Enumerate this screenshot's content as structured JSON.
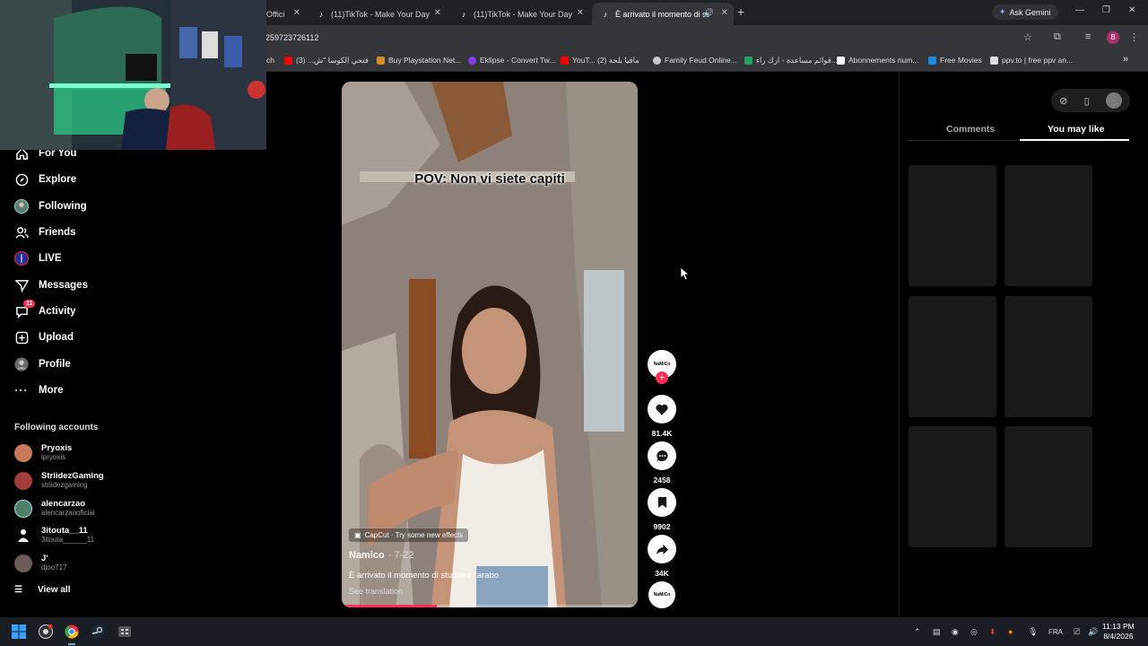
{
  "browser": {
    "tabs": [
      {
        "title": "Offici",
        "active": false
      },
      {
        "title": "(11)TikTok - Make Your Day",
        "active": false
      },
      {
        "title": "(11)TikTok - Make Your Day",
        "active": false
      },
      {
        "title": "È arrivato il momento di stu",
        "active": true
      }
    ],
    "ask_gemini": "Ask Gemini",
    "url": "259723726112",
    "profile_initial": "B",
    "bookmarks": [
      {
        "label": "ch",
        "color": "#888888"
      },
      {
        "label": "فتحي الكوسا \"ش... (3)",
        "color": "#ff0000"
      },
      {
        "label": "Buy Playstation Net...",
        "color": "#d58b2a"
      },
      {
        "label": "Eklipse - Convert Tw...",
        "color": "#8a3bf2"
      },
      {
        "label": "YouT... مافيا بلحة (2)",
        "color": "#ff0000"
      },
      {
        "label": "Family Feud Online...",
        "color": "#cccccc"
      },
      {
        "label": "قوائم مساعدة - ارك راء...",
        "color": "#1ea362"
      },
      {
        "label": "Abonnements num...",
        "color": "#ffffff"
      },
      {
        "label": "Free Movies",
        "color": "#1e88e5"
      },
      {
        "label": "ppv.to | free ppv an...",
        "color": "#dddddd"
      }
    ]
  },
  "sidebar": {
    "nav": [
      {
        "label": "For You",
        "icon": "home-icon"
      },
      {
        "label": "Explore",
        "icon": "compass-icon"
      },
      {
        "label": "Following",
        "icon": "avatar-icon"
      },
      {
        "label": "Friends",
        "icon": "friends-icon"
      },
      {
        "label": "LIVE",
        "icon": "live-icon"
      },
      {
        "label": "Messages",
        "icon": "send-icon"
      },
      {
        "label": "Activity",
        "icon": "activity-icon",
        "badge": "11"
      },
      {
        "label": "Upload",
        "icon": "upload-icon"
      },
      {
        "label": "Profile",
        "icon": "profile-icon"
      },
      {
        "label": "More",
        "icon": "more-icon"
      }
    ],
    "following_title": "Following accounts",
    "accounts": [
      {
        "name": "Pryoxis",
        "handle": "lpryoxis",
        "color": "#c97a5a"
      },
      {
        "name": "StriidezGaming",
        "handle": "striidezgaming",
        "color": "#a53c3c"
      },
      {
        "name": "alencarzao",
        "handle": "alencarzaooficial",
        "color": "#4f7f6b"
      },
      {
        "name": "3itouta__11",
        "handle": "3itouta______11",
        "color": "#ffffff"
      },
      {
        "name": "J'",
        "handle": "djoo717",
        "color": "#6d5b57"
      }
    ],
    "view_all": "View all"
  },
  "video": {
    "caption": "POV: Non vi siete capiti",
    "effect": "CapCut · Try some new effects",
    "creator": "Namico",
    "date": "· 7-22",
    "description": "È arrivato il momento di studiare l'arabo",
    "see_translation": "See translation",
    "progress": 0.32
  },
  "actions": {
    "creator_avatar_text": "NaMiCo",
    "likes": "81.4K",
    "comments": "2458",
    "saves": "9902",
    "shares": "34K"
  },
  "right_panel": {
    "tabs": [
      "Comments",
      "You may like"
    ],
    "active_tab": "You may like"
  },
  "taskbar": {
    "lang": "FRA",
    "time": "11:13 PM",
    "date": "8/4/2026"
  }
}
